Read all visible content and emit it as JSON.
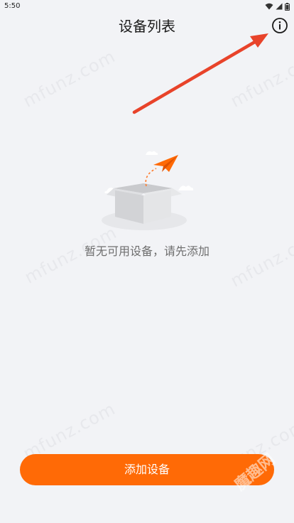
{
  "status_bar": {
    "time": "5:50",
    "icons": [
      "wifi-icon",
      "signal-icon",
      "battery-icon"
    ]
  },
  "header": {
    "title": "设备列表",
    "info_icon": "info-icon"
  },
  "empty_state": {
    "message": "暂无可用设备，请先添加",
    "illustration": "empty-box-paper-plane"
  },
  "actions": {
    "add_device_label": "添加设备"
  },
  "watermarks": {
    "site": "mfunz.com",
    "brand": "魔趣网"
  },
  "colors": {
    "accent": "#ff6a06",
    "background": "#f2f3f6",
    "annotation_arrow": "#e8432a"
  }
}
